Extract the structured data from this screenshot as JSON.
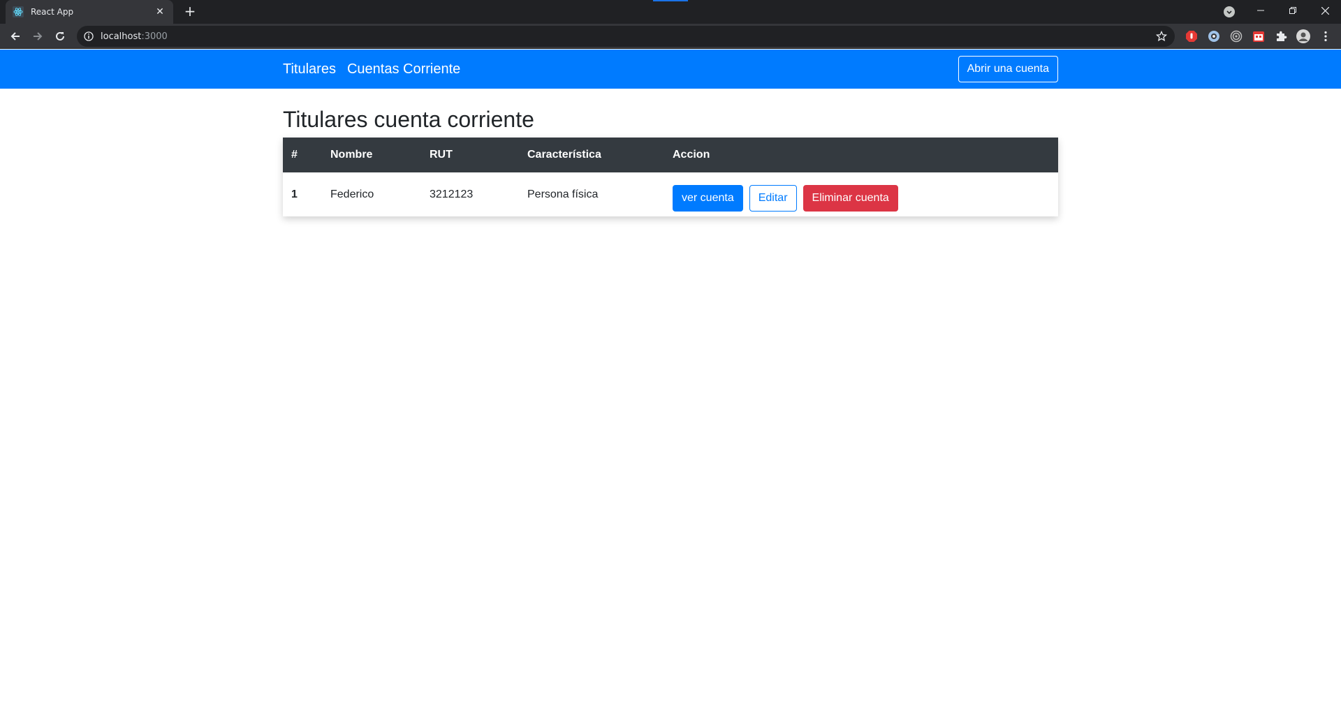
{
  "browser": {
    "tab_title": "React App",
    "url_host": "localhost",
    "url_port": ":3000"
  },
  "navbar": {
    "links": [
      "Titulares",
      "Cuentas Corriente"
    ],
    "open_account_label": "Abrir una cuenta",
    "color": "#007bff"
  },
  "main": {
    "title": "Titulares cuenta corriente",
    "table": {
      "headers": [
        "#",
        "Nombre",
        "RUT",
        "Característica",
        "Accion"
      ],
      "rows": [
        {
          "num": "1",
          "nombre": "Federico",
          "rut": "3212123",
          "caracteristica": "Persona física",
          "actions": {
            "view": "ver cuenta",
            "edit": "Editar",
            "delete": "Eliminar cuenta"
          }
        }
      ]
    }
  },
  "colors": {
    "primary": "#007bff",
    "danger": "#dc3545",
    "table_header": "#343a40"
  },
  "icons": {
    "favicon": "react-icon",
    "back": "arrow-left-icon",
    "forward": "arrow-right-icon",
    "reload": "reload-icon",
    "info": "info-icon",
    "star": "star-icon",
    "extensions": "puzzle-icon",
    "menu": "kebab-menu-icon"
  }
}
